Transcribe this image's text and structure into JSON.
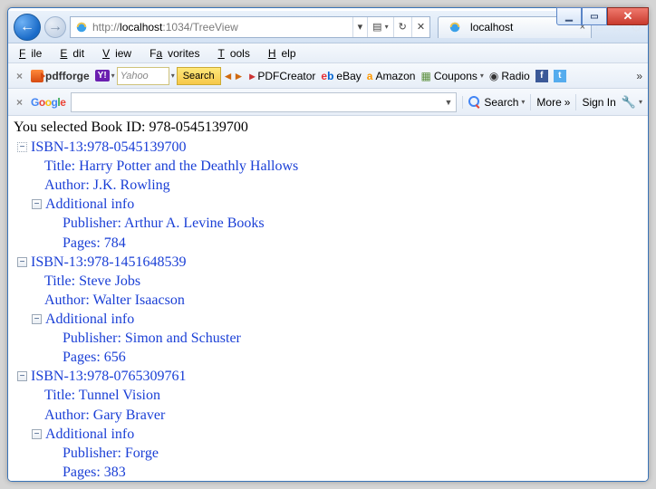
{
  "window": {
    "minimize": "▁",
    "maximize": "▭",
    "close": "✕"
  },
  "nav": {
    "back_glyph": "←",
    "fwd_glyph": "→",
    "url_prefix": "http://",
    "url_host": "localhost",
    "url_rest": ":1034/TreeView",
    "dropdown": "▾",
    "refresh": "↻",
    "stop": "✕",
    "bing_icon": "▤"
  },
  "tab": {
    "title": "localhost",
    "close": "×"
  },
  "chrome": {
    "home": "⌂",
    "fav": "☆",
    "gear": "⚙"
  },
  "menu": {
    "file": "File",
    "edit": "Edit",
    "view": "View",
    "favorites": "Favorites",
    "tools": "Tools",
    "help": "Help"
  },
  "toolbar": {
    "x": "×",
    "pdfforge": "pdfforge",
    "yahoo_badge": "Y!",
    "yahoo_placeholder": "Yahoo",
    "yahoo_search": "Search",
    "pdfcreator": "PDFCreator",
    "ebay": "eBay",
    "amazon": "Amazon",
    "coupons": "Coupons",
    "radio": "Radio",
    "fb": "f",
    "tw": "t",
    "chevrons": "»"
  },
  "google": {
    "x": "×",
    "g": "G",
    "o1": "o",
    "o2": "o",
    "g2": "g",
    "l": "l",
    "e": "e",
    "search": "Search",
    "more": "More",
    "signin": "Sign In",
    "chev": "»"
  },
  "content": {
    "selected_label": "You selected Book ID: ",
    "selected_id": "978-0545139700",
    "books": [
      {
        "isbn_label": "ISBN-13:978-0545139700",
        "title": "Title: Harry Potter and the Deathly Hallows",
        "author": "Author: J.K. Rowling",
        "addl": "Additional info",
        "publisher": "Publisher: Arthur A. Levine Books",
        "pages": "Pages: 784",
        "root_expander_dashed": true
      },
      {
        "isbn_label": "ISBN-13:978-1451648539",
        "title": "Title: Steve Jobs",
        "author": "Author: Walter Isaacson",
        "addl": "Additional info",
        "publisher": "Publisher: Simon and Schuster",
        "pages": "Pages: 656",
        "root_expander_dashed": false
      },
      {
        "isbn_label": "ISBN-13:978-0765309761",
        "title": "Title: Tunnel Vision",
        "author": "Author: Gary Braver",
        "addl": "Additional info",
        "publisher": "Publisher: Forge",
        "pages": "Pages: 383",
        "root_expander_dashed": false
      }
    ]
  }
}
